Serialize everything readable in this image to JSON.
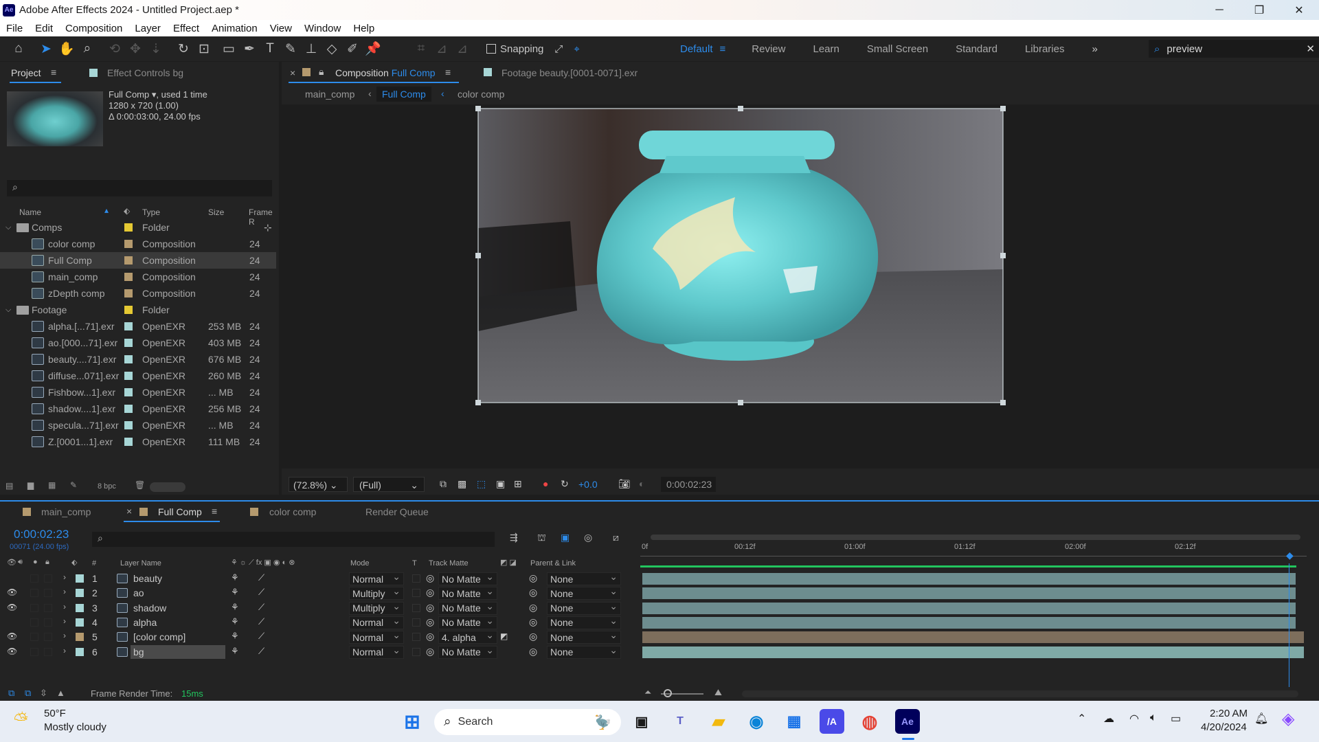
{
  "window": {
    "title": "Adobe After Effects 2024 - Untitled Project.aep *",
    "app_badge": "Ae"
  },
  "menu": [
    "File",
    "Edit",
    "Composition",
    "Layer",
    "Effect",
    "Animation",
    "View",
    "Window",
    "Help"
  ],
  "toolbar": {
    "snapping_label": "Snapping",
    "workspaces": [
      "Default",
      "Review",
      "Learn",
      "Small Screen",
      "Standard",
      "Libraries"
    ],
    "active_workspace": "Default",
    "search_value": "preview"
  },
  "project_panel": {
    "tab_project": "Project",
    "tab_effects": "Effect Controls bg",
    "preview_name": "Full Comp",
    "preview_used": ", used 1 time",
    "preview_res": "1280 x 720 (1.00)",
    "preview_dur": "Δ 0:00:03:00, 24.00 fps",
    "columns": {
      "name": "Name",
      "type": "Type",
      "size": "Size",
      "frame": "Frame R"
    },
    "rows": [
      {
        "kind": "folder",
        "name": "Comps",
        "type": "Folder",
        "size": "",
        "fr": "",
        "color": "#e5c933"
      },
      {
        "kind": "comp",
        "name": "color comp",
        "type": "Composition",
        "size": "",
        "fr": "24",
        "color": "#b59a6e"
      },
      {
        "kind": "comp",
        "name": "Full Comp",
        "type": "Composition",
        "size": "",
        "fr": "24",
        "color": "#b59a6e",
        "selected": true
      },
      {
        "kind": "comp",
        "name": "main_comp",
        "type": "Composition",
        "size": "",
        "fr": "24",
        "color": "#b59a6e"
      },
      {
        "kind": "comp",
        "name": "zDepth comp",
        "type": "Composition",
        "size": "",
        "fr": "24",
        "color": "#b59a6e"
      },
      {
        "kind": "folder",
        "name": "Footage",
        "type": "Folder",
        "size": "",
        "fr": "",
        "color": "#e5c933"
      },
      {
        "kind": "foot",
        "name": "alpha.[...71].exr",
        "type": "OpenEXR",
        "size": "253 MB",
        "fr": "24",
        "color": "#a7d6d6"
      },
      {
        "kind": "foot",
        "name": "ao.[000...71].exr",
        "type": "OpenEXR",
        "size": "403 MB",
        "fr": "24",
        "color": "#a7d6d6"
      },
      {
        "kind": "foot",
        "name": "beauty....71].exr",
        "type": "OpenEXR",
        "size": "676 MB",
        "fr": "24",
        "color": "#a7d6d6"
      },
      {
        "kind": "foot",
        "name": "diffuse...071].exr",
        "type": "OpenEXR",
        "size": "260 MB",
        "fr": "24",
        "color": "#a7d6d6"
      },
      {
        "kind": "foot",
        "name": "Fishbow...1].exr",
        "type": "OpenEXR",
        "size": "... MB",
        "fr": "24",
        "color": "#a7d6d6"
      },
      {
        "kind": "foot",
        "name": "shadow....1].exr",
        "type": "OpenEXR",
        "size": "256 MB",
        "fr": "24",
        "color": "#a7d6d6"
      },
      {
        "kind": "foot",
        "name": "specula...71].exr",
        "type": "OpenEXR",
        "size": "... MB",
        "fr": "24",
        "color": "#a7d6d6"
      },
      {
        "kind": "foot",
        "name": "Z.[0001...1].exr",
        "type": "OpenEXR",
        "size": "111 MB",
        "fr": "24",
        "color": "#a7d6d6"
      }
    ],
    "bpc": "8 bpc"
  },
  "viewer": {
    "tab_comp_prefix": "Composition",
    "tab_comp_name": "Full Comp",
    "tab_footage": "Footage  beauty.[0001-0071].exr",
    "crumbs": [
      "main_comp",
      "Full Comp",
      "color comp"
    ],
    "zoom": "(72.8%)",
    "resolution": "(Full)",
    "exposure": "+0.0",
    "timecode": "0:00:02:23"
  },
  "timeline": {
    "tabs": [
      "main_comp",
      "Full Comp",
      "color comp",
      "Render Queue"
    ],
    "timecode": "0:00:02:23",
    "frame_info": "00071 (24.00 fps)",
    "col_layer_name": "Layer Name",
    "col_mode": "Mode",
    "col_t": "T",
    "col_track_matte": "Track Matte",
    "col_parent": "Parent & Link",
    "col_num": "#",
    "ruler": [
      "0f",
      "00:12f",
      "01:00f",
      "01:12f",
      "02:00f",
      "02:12f"
    ],
    "layers": [
      {
        "num": "1",
        "name": "beauty",
        "mode": "Normal",
        "matte": "No Matte",
        "parent": "None",
        "eye": false,
        "color": "#a7d6d6",
        "bar": "#6d8d8f"
      },
      {
        "num": "2",
        "name": "ao",
        "mode": "Multiply",
        "matte": "No Matte",
        "parent": "None",
        "eye": true,
        "color": "#a7d6d6",
        "bar": "#6d8d8f"
      },
      {
        "num": "3",
        "name": "shadow",
        "mode": "Multiply",
        "matte": "No Matte",
        "parent": "None",
        "eye": true,
        "color": "#a7d6d6",
        "bar": "#6d8d8f"
      },
      {
        "num": "4",
        "name": "alpha",
        "mode": "Normal",
        "matte": "No Matte",
        "parent": "None",
        "eye": false,
        "color": "#a7d6d6",
        "bar": "#6d8d8f"
      },
      {
        "num": "5",
        "name": "[color comp]",
        "mode": "Normal",
        "matte": "4. alpha",
        "parent": "None",
        "eye": true,
        "color": "#b59a6e",
        "bar": "#7d6e5c"
      },
      {
        "num": "6",
        "name": "bg",
        "mode": "Normal",
        "matte": "No Matte",
        "parent": "None",
        "eye": true,
        "color": "#a7d6d6",
        "bar": "#7fa9a6",
        "selected": true
      }
    ],
    "render_time_label": "Frame Render Time:",
    "render_time_value": "15ms"
  },
  "taskbar": {
    "weather_temp": "50°F",
    "weather_desc": "Mostly cloudy",
    "search_label": "Search",
    "time": "2:20 AM",
    "date": "4/20/2024"
  },
  "colors": {
    "accent": "#2d8ceb",
    "panel": "#232323",
    "bg": "#1d1d1d",
    "green": "#22c55e"
  }
}
